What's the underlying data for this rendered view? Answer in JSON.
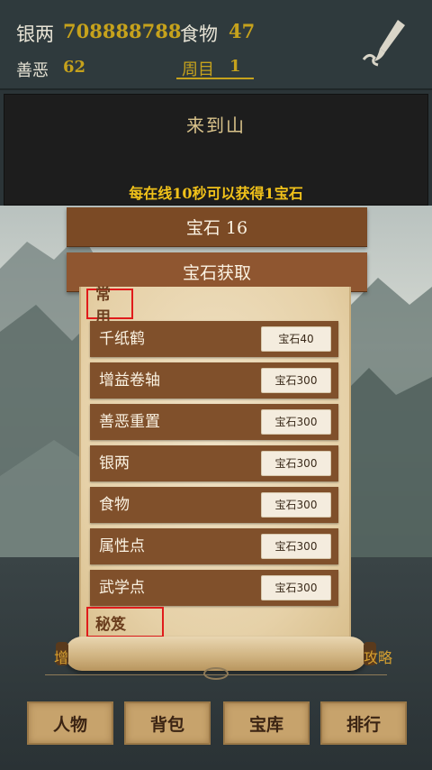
{
  "status": {
    "silver_label": "银两",
    "silver_value": "708888788",
    "food_label": "食物",
    "food_value": "47",
    "karma_label": "善恶",
    "karma_value": "62",
    "cycle_label": "周目",
    "cycle_value": "1"
  },
  "message": {
    "title": "来到山",
    "note": "每在线10秒可以获得1宝石"
  },
  "gems": {
    "count_label": "宝石 16",
    "acquire_label": "宝石获取"
  },
  "scroll": {
    "section_common": "常用",
    "section_secret": "秘笈",
    "items": [
      {
        "name": "千纸鹤",
        "price": "宝石40"
      },
      {
        "name": "增益卷轴",
        "price": "宝石300"
      },
      {
        "name": "善恶重置",
        "price": "宝石300"
      },
      {
        "name": "银两",
        "price": "宝石300"
      },
      {
        "name": "食物",
        "price": "宝石300"
      },
      {
        "name": "属性点",
        "price": "宝石300"
      },
      {
        "name": "武学点",
        "price": "宝石300"
      }
    ]
  },
  "side": {
    "left_partial": "增",
    "right_partial": "攻略"
  },
  "nav": {
    "person": "人物",
    "bag": "背包",
    "vault": "宝库",
    "rank": "排行"
  },
  "colors": {
    "gold": "#c6a21c",
    "brown_bar": "#7b4a25",
    "item_bar": "#80502b",
    "highlight_red": "#e01b1b"
  },
  "icons": {
    "brush": "brush-icon"
  }
}
